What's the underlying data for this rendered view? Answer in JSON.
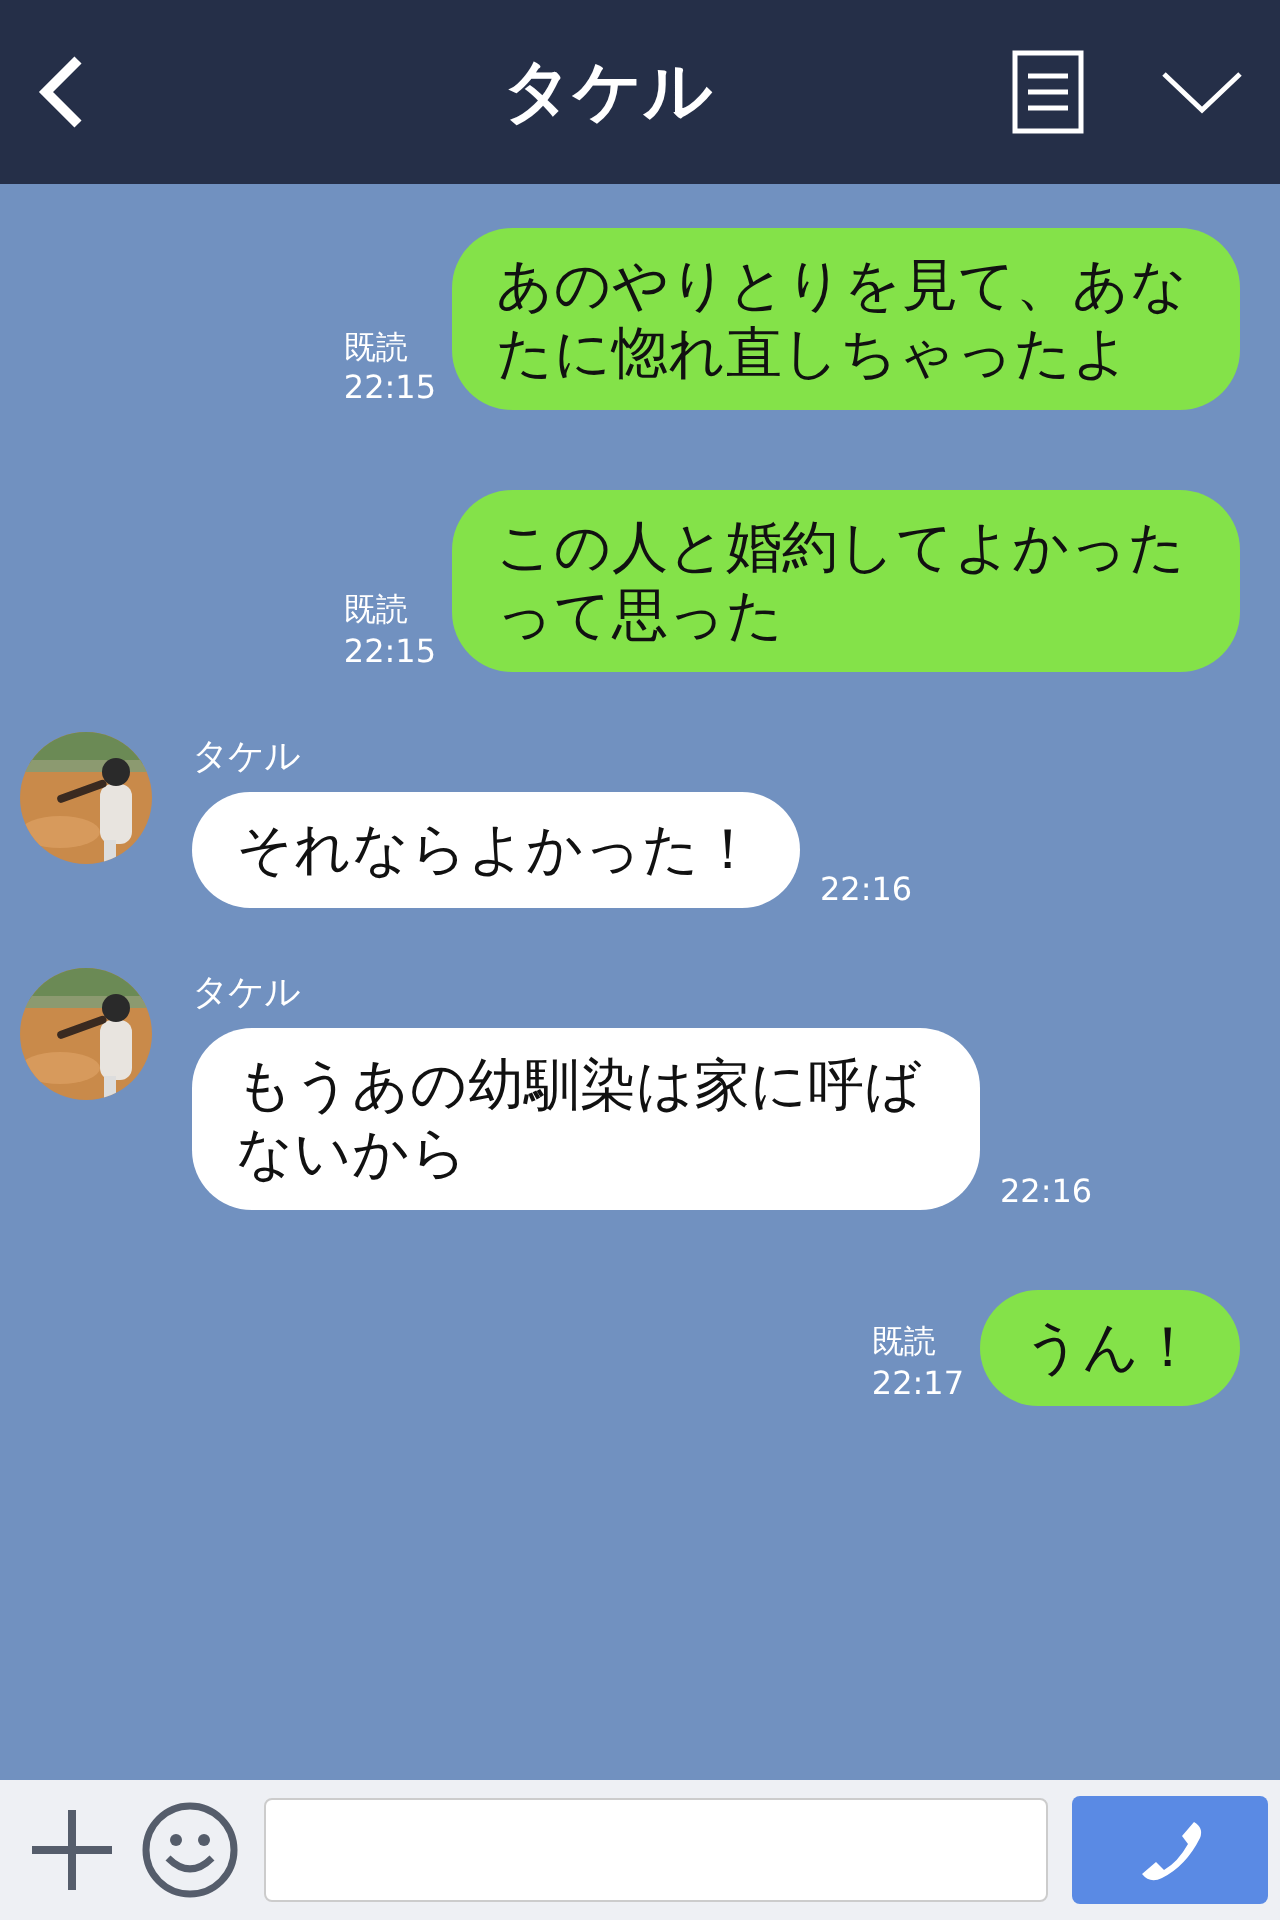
{
  "header": {
    "title": "タケル"
  },
  "messages": [
    {
      "kind": "sent",
      "text": "あのやりとりを見て、あなたに惚れ直しちゃったよ",
      "read": "既読",
      "time": "22:15"
    },
    {
      "kind": "sent",
      "text": "この人と婚約してよかったって思った",
      "read": "既読",
      "time": "22:15"
    },
    {
      "kind": "received",
      "sender": "タケル",
      "text": "それならよかった！",
      "time": "22:16"
    },
    {
      "kind": "received",
      "sender": "タケル",
      "text": "もうあの幼馴染は家に呼ばないから",
      "time": "22:16"
    },
    {
      "kind": "sent",
      "text": "うん！",
      "read": "既読",
      "time": "22:17"
    }
  ]
}
